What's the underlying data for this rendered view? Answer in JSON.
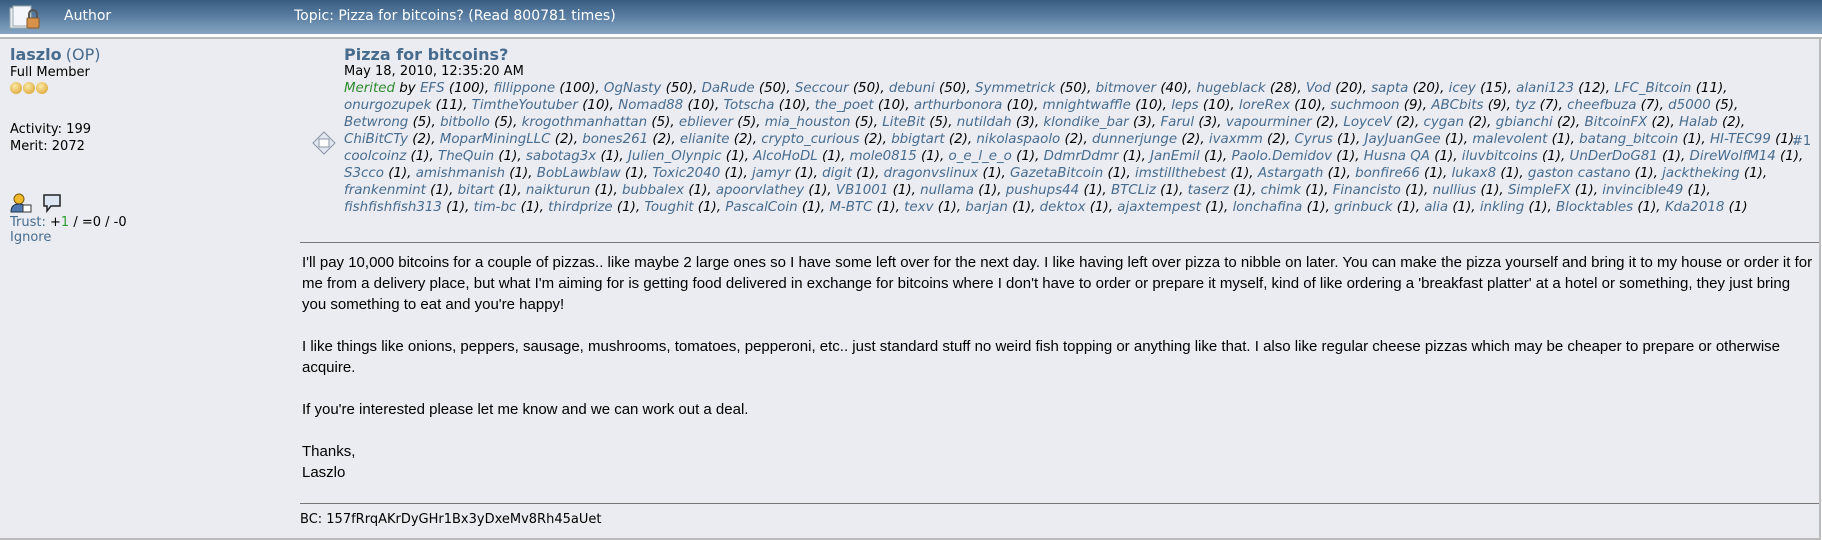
{
  "header": {
    "author_label": "Author",
    "topic_title": "Topic: Pizza for bitcoins?  (Read 800781 times)"
  },
  "poster": {
    "name": "laszlo",
    "op_tag": "(OP)",
    "rank": "Full Member",
    "activity": "Activity: 199",
    "merit": "Merit: 2072",
    "trust_label": "Trust:",
    "trust_plus": "+",
    "trust_pos": "1",
    "trust_rest": " / =0 / -0",
    "ignore": "Ignore"
  },
  "post": {
    "subject": "Pizza for bitcoins?",
    "date": "May 18, 2010, 12:35:20 AM",
    "number": "#1",
    "merited_label": "Merited",
    "merited_by": " by ",
    "merits": [
      [
        "EFS",
        "100"
      ],
      [
        "fillippone",
        "100"
      ],
      [
        "OgNasty",
        "50"
      ],
      [
        "DaRude",
        "50"
      ],
      [
        "Seccour",
        "50"
      ],
      [
        "debuni",
        "50"
      ],
      [
        "Symmetrick",
        "50"
      ],
      [
        "bitmover",
        "40"
      ],
      [
        "hugeblack",
        "28"
      ],
      [
        "Vod",
        "20"
      ],
      [
        "sapta",
        "20"
      ],
      [
        "icey",
        "15"
      ],
      [
        "alani123",
        "12"
      ],
      [
        "LFC_Bitcoin",
        "11"
      ],
      [
        "onurgozupek",
        "11"
      ],
      [
        "TimtheYoutuber",
        "10"
      ],
      [
        "Nomad88",
        "10"
      ],
      [
        "Totscha",
        "10"
      ],
      [
        "the_poet",
        "10"
      ],
      [
        "arthurbonora",
        "10"
      ],
      [
        "mnightwaffle",
        "10"
      ],
      [
        "leps",
        "10"
      ],
      [
        "loreRex",
        "10"
      ],
      [
        "suchmoon",
        "9"
      ],
      [
        "ABCbits",
        "9"
      ],
      [
        "tyz",
        "7"
      ],
      [
        "cheefbuza",
        "7"
      ],
      [
        "d5000",
        "5"
      ],
      [
        "Betwrong",
        "5"
      ],
      [
        "bitbollo",
        "5"
      ],
      [
        "krogothmanhattan",
        "5"
      ],
      [
        "ebliever",
        "5"
      ],
      [
        "mia_houston",
        "5"
      ],
      [
        "LiteBit",
        "5"
      ],
      [
        "nutildah",
        "3"
      ],
      [
        "klondike_bar",
        "3"
      ],
      [
        "Farul",
        "3"
      ],
      [
        "vapourminer",
        "2"
      ],
      [
        "LoyceV",
        "2"
      ],
      [
        "cygan",
        "2"
      ],
      [
        "gbianchi",
        "2"
      ],
      [
        "BitcoinFX",
        "2"
      ],
      [
        "Halab",
        "2"
      ],
      [
        "ChiBitCTy",
        "2"
      ],
      [
        "MoparMiningLLC",
        "2"
      ],
      [
        "bones261",
        "2"
      ],
      [
        "elianite",
        "2"
      ],
      [
        "crypto_curious",
        "2"
      ],
      [
        "bbigtart",
        "2"
      ],
      [
        "nikolaspaolo",
        "2"
      ],
      [
        "dunnerjunge",
        "2"
      ],
      [
        "ivaxmm",
        "2"
      ],
      [
        "Cyrus",
        "1"
      ],
      [
        "JayJuanGee",
        "1"
      ],
      [
        "malevolent",
        "1"
      ],
      [
        "batang_bitcoin",
        "1"
      ],
      [
        "HI-TEC99",
        "1"
      ],
      [
        "coolcoinz",
        "1"
      ],
      [
        "TheQuin",
        "1"
      ],
      [
        "sabotag3x",
        "1"
      ],
      [
        "Julien_Olynpic",
        "1"
      ],
      [
        "AlcoHoDL",
        "1"
      ],
      [
        "mole0815",
        "1"
      ],
      [
        "o_e_l_e_o",
        "1"
      ],
      [
        "DdmrDdmr",
        "1"
      ],
      [
        "JanEmil",
        "1"
      ],
      [
        "Paolo.Demidov",
        "1"
      ],
      [
        "Husna QA",
        "1"
      ],
      [
        "iluvbitcoins",
        "1"
      ],
      [
        "UnDerDoG81",
        "1"
      ],
      [
        "DireWolfM14",
        "1"
      ],
      [
        "S3cco",
        "1"
      ],
      [
        "amishmanish",
        "1"
      ],
      [
        "BobLawblaw",
        "1"
      ],
      [
        "Toxic2040",
        "1"
      ],
      [
        "jamyr",
        "1"
      ],
      [
        "digit",
        "1"
      ],
      [
        "dragonvslinux",
        "1"
      ],
      [
        "GazetaBitcoin",
        "1"
      ],
      [
        "imstillthebest",
        "1"
      ],
      [
        "Astargath",
        "1"
      ],
      [
        "bonfire66",
        "1"
      ],
      [
        "lukax8",
        "1"
      ],
      [
        "gaston castano",
        "1"
      ],
      [
        "jacktheking",
        "1"
      ],
      [
        "frankenmint",
        "1"
      ],
      [
        "bitart",
        "1"
      ],
      [
        "naikturun",
        "1"
      ],
      [
        "bubbalex",
        "1"
      ],
      [
        "apoorvlathey",
        "1"
      ],
      [
        "VB1001",
        "1"
      ],
      [
        "nullama",
        "1"
      ],
      [
        "pushups44",
        "1"
      ],
      [
        "BTCLiz",
        "1"
      ],
      [
        "taserz",
        "1"
      ],
      [
        "chimk",
        "1"
      ],
      [
        "Financisto",
        "1"
      ],
      [
        "nullius",
        "1"
      ],
      [
        "SimpleFX",
        "1"
      ],
      [
        "invincible49",
        "1"
      ],
      [
        "fishfishfish313",
        "1"
      ],
      [
        "tim-bc",
        "1"
      ],
      [
        "thirdprize",
        "1"
      ],
      [
        "Toughit",
        "1"
      ],
      [
        "PascalCoin",
        "1"
      ],
      [
        "M-BTC",
        "1"
      ],
      [
        "texv",
        "1"
      ],
      [
        "barjan",
        "1"
      ],
      [
        "dektox",
        "1"
      ],
      [
        "ajaxtempest",
        "1"
      ],
      [
        "lonchafina",
        "1"
      ],
      [
        "grinbuck",
        "1"
      ],
      [
        "alia",
        "1"
      ],
      [
        "inkling",
        "1"
      ],
      [
        "Blocktables",
        "1"
      ],
      [
        "Kda2018",
        "1"
      ]
    ],
    "body": [
      "I'll pay 10,000 bitcoins for a couple of pizzas.. like maybe 2 large ones so I have some left over for the next day.  I like having left over pizza to nibble on later.  You can make the pizza yourself and bring it to my house or order it for me from a delivery place, but what I'm aiming for is getting food delivered in exchange for bitcoins where I don't have to order or prepare it myself, kind of like ordering a 'breakfast platter' at a hotel or something, they just bring you something to eat and you're happy!",
      "I like things like onions, peppers, sausage, mushrooms, tomatoes, pepperoni, etc.. just standard stuff no weird fish topping or anything like that.  I also like regular cheese pizzas which may be cheaper to prepare or otherwise acquire.",
      "If you're interested please let me know and we can work out a deal.",
      "Thanks,\nLaszlo"
    ],
    "signature": "BC: 157fRrqAKrDyGHr1Bx3yDxeMv8Rh45aUet"
  }
}
